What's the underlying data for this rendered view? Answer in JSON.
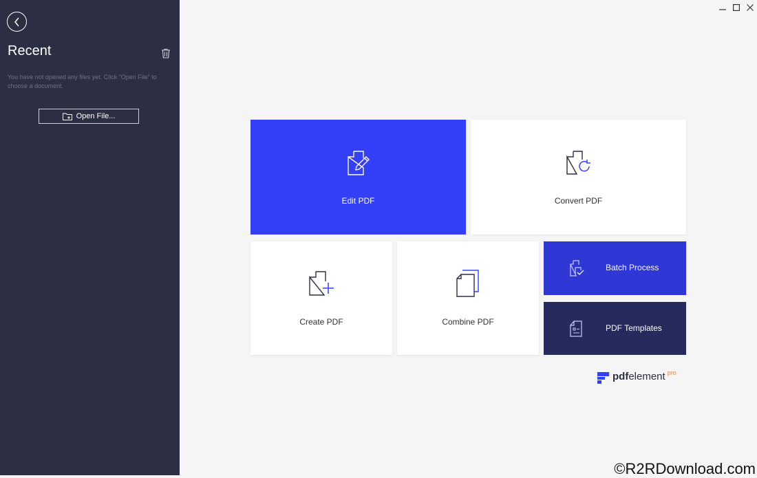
{
  "sidebar": {
    "title": "Recent",
    "empty_message": "You have not opened any files yet. Click “Open File” to choose a document.",
    "open_file_label": "Open File..."
  },
  "tiles": {
    "edit": {
      "label": "Edit PDF",
      "color": "#3440f7"
    },
    "convert": {
      "label": "Convert PDF"
    },
    "create": {
      "label": "Create PDF"
    },
    "combine": {
      "label": "Combine PDF"
    },
    "batch": {
      "label": "Batch Process",
      "color": "#2f37d5"
    },
    "templates": {
      "label": "PDF Templates",
      "color": "#262a5c"
    }
  },
  "brand": {
    "name_bold": "pdf",
    "name_rest": "element",
    "edition": "pro"
  },
  "watermark": "©R2RDownload.com",
  "colors": {
    "sidebar_bg": "#2c2e43",
    "content_bg": "#f5f5f6",
    "accent_orange": "#f08a24"
  }
}
